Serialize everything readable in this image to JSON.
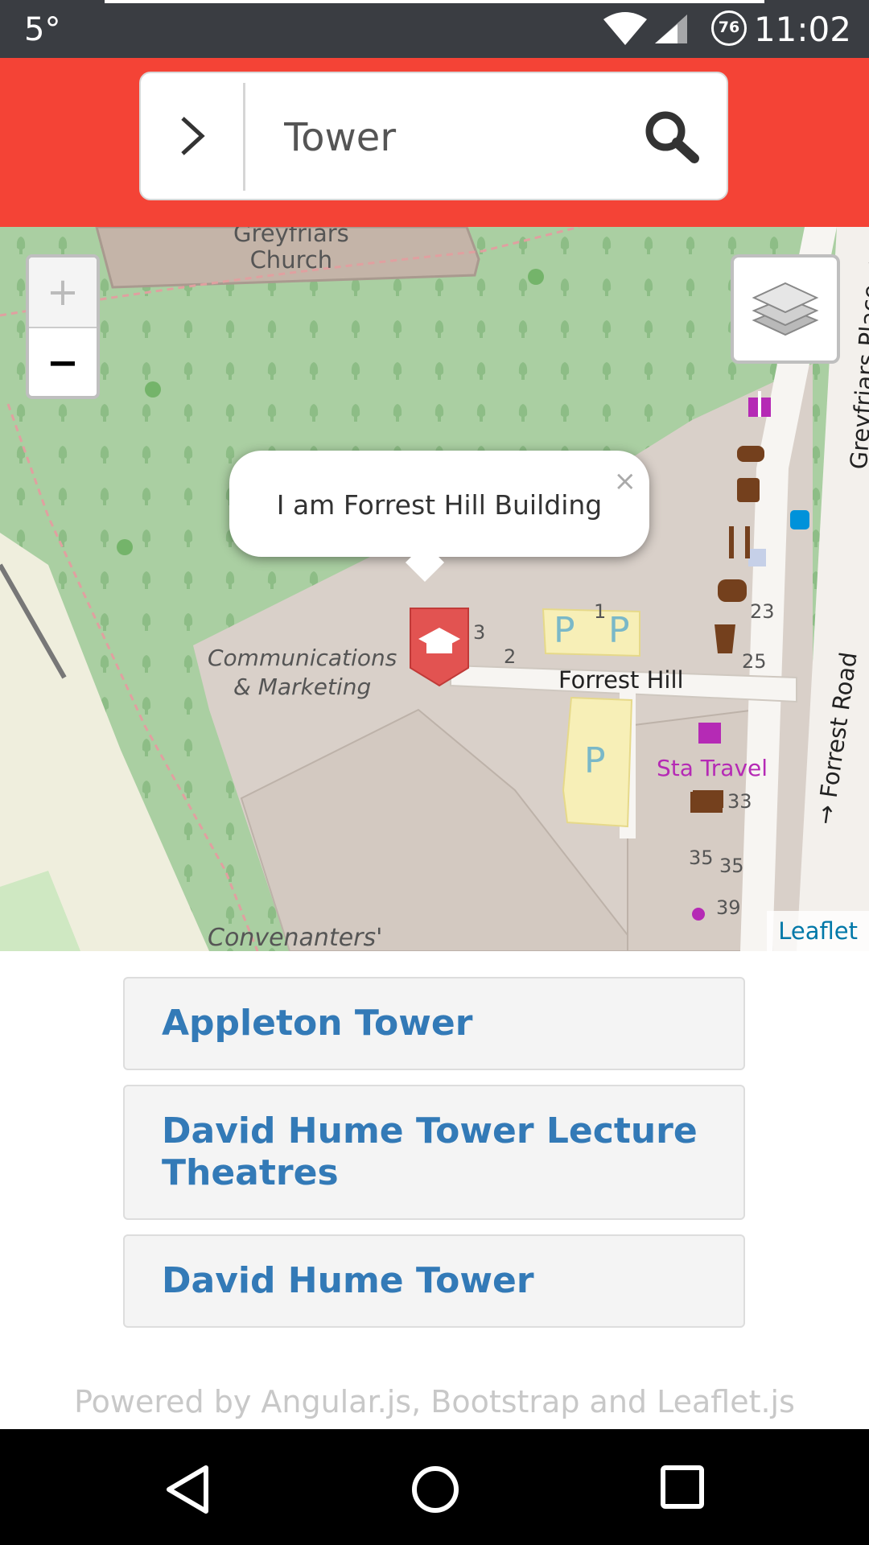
{
  "status_bar": {
    "temperature": "5°",
    "battery_level": "76",
    "time": "11:02"
  },
  "search": {
    "query": "Tower",
    "toggle_icon": "chevron-right-icon",
    "search_icon": "search-icon"
  },
  "map": {
    "labels": {
      "church": "Greyfriars Church",
      "church_line1": "Greyfriars",
      "church_line2": "Church",
      "comms_line1": "Communications",
      "comms_line2": "& Marketing",
      "forrest_hill": "Forrest Hill",
      "forrest_road": "→ Forrest Road",
      "greyfriars_place": "Greyfriars Place →",
      "sta_travel": "Sta Travel",
      "convenanters": "Convenanters'",
      "parking": "P",
      "num_1": "1",
      "num_2": "2",
      "num_3": "3",
      "num_23": "23",
      "num_25": "25",
      "num_33": "33",
      "num_35a": "35",
      "num_35b": "35",
      "num_39": "39"
    },
    "zoom_in": "+",
    "zoom_out": "−",
    "popup_text": "I am Forrest Hill Building",
    "popup_close": "×",
    "attribution": "Leaflet",
    "colors": {
      "park": "#aacfa2",
      "building": "#d9d0c9",
      "parking": "#f7efb7",
      "marker": "#e25351"
    }
  },
  "results": [
    {
      "label": "Appleton Tower"
    },
    {
      "label": "David Hume Tower Lecture Theatres"
    },
    {
      "label": "David Hume Tower"
    }
  ],
  "footer": {
    "text": "Powered by Angular.js, Bootstrap and Leaflet.js"
  },
  "colors": {
    "header": "#f44336",
    "status_bar": "#3a3d42",
    "link": "#337ab7"
  }
}
